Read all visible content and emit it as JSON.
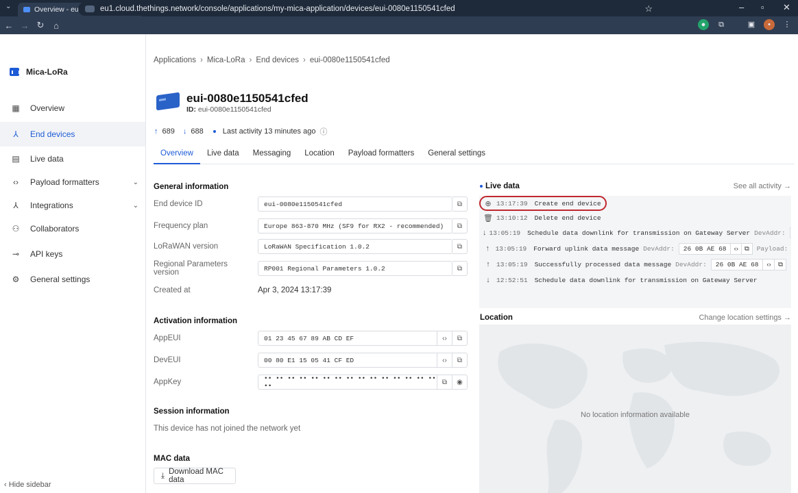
{
  "browser": {
    "tab_title": "Overview - eui-0080e1150541c",
    "url": "eu1.cloud.thethings.network/console/applications/my-mica-application/devices/eui-0080e1150541cfed"
  },
  "sidebar": {
    "brand": "Mica-LoRa",
    "items": [
      {
        "label": "Overview",
        "icon": "grid-icon"
      },
      {
        "label": "End devices",
        "icon": "end-devices-icon"
      },
      {
        "label": "Live data",
        "icon": "live-data-icon"
      },
      {
        "label": "Payload formatters",
        "icon": "code-icon"
      },
      {
        "label": "Integrations",
        "icon": "integrations-icon"
      },
      {
        "label": "Collaborators",
        "icon": "people-icon"
      },
      {
        "label": "API keys",
        "icon": "key-icon"
      },
      {
        "label": "General settings",
        "icon": "gear-icon"
      }
    ],
    "hide_label": "Hide sidebar"
  },
  "breadcrumb": [
    "Applications",
    "Mica-LoRa",
    "End devices",
    "eui-0080e1150541cfed"
  ],
  "device": {
    "title": "eui-0080e1150541cfed",
    "id_label": "ID:",
    "id_value": "eui-0080e1150541cfed",
    "uplink_count": "689",
    "downlink_count": "688",
    "last_activity": "Last activity 13 minutes ago"
  },
  "tabs": [
    "Overview",
    "Live data",
    "Messaging",
    "Location",
    "Payload formatters",
    "General settings"
  ],
  "general": {
    "heading": "General information",
    "fields": [
      {
        "label": "End device ID",
        "value": "eui-0080e1150541cfed"
      },
      {
        "label": "Frequency plan",
        "value": "Europe 863-870 MHz (SF9 for RX2 - recommended)"
      },
      {
        "label": "LoRaWAN version",
        "value": "LoRaWAN Specification 1.0.2"
      },
      {
        "label": "Regional Parameters version",
        "value": "RP001 Regional Parameters 1.0.2"
      }
    ],
    "created_label": "Created at",
    "created_value": "Apr 3, 2024 13:17:39"
  },
  "activation": {
    "heading": "Activation information",
    "fields": [
      {
        "label": "AppEUI",
        "value": "01 23 45 67 89 AB CD EF"
      },
      {
        "label": "DevEUI",
        "value": "00 80 E1 15 05 41 CF ED"
      },
      {
        "label": "AppKey",
        "value": "•• •• •• •• •• •• •• •• •• •• •• •• •• •• •• ••"
      }
    ]
  },
  "session": {
    "heading": "Session information",
    "text": "This device has not joined the network yet"
  },
  "mac": {
    "heading": "MAC data",
    "button": "Download MAC data"
  },
  "live_data": {
    "heading": "Live data",
    "link": "See all activity →",
    "events": [
      {
        "time": "13:17:39",
        "text": "Create end device",
        "icon": "plus-circle-icon"
      },
      {
        "time": "13:10:12",
        "text": "Delete end device",
        "icon": "trash-icon"
      },
      {
        "time": "13:05:19",
        "text": "Schedule data downlink for transmission on Gateway Server",
        "key": "DevAddr:",
        "icon": "arrow-down-icon"
      },
      {
        "time": "13:05:19",
        "text": "Forward uplink data message",
        "key": "DevAddr:",
        "chip": "26 0B AE 68",
        "key2": "Payload:",
        "icon": "arrow-up-icon"
      },
      {
        "time": "13:05:19",
        "text": "Successfully processed data message",
        "key": "DevAddr:",
        "chip": "26 0B AE 68",
        "icon": "arrow-up-icon"
      },
      {
        "time": "12:52:51",
        "text": "Schedule data downlink for transmission on Gateway Server",
        "icon": "arrow-down-icon"
      }
    ]
  },
  "location": {
    "heading": "Location",
    "link": "Change location settings →",
    "empty": "No location information available"
  }
}
